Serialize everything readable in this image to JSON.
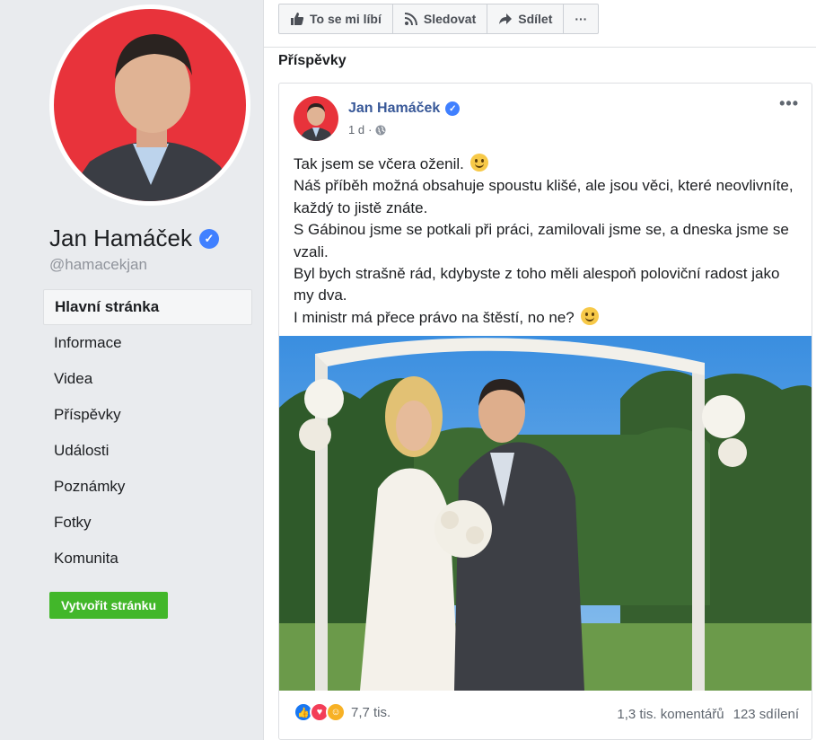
{
  "sidebar": {
    "page_name": "Jan Hamáček",
    "handle": "@hamacekjan",
    "nav": [
      {
        "label": "Hlavní stránka"
      },
      {
        "label": "Informace"
      },
      {
        "label": "Videa"
      },
      {
        "label": "Příspěvky"
      },
      {
        "label": "Události"
      },
      {
        "label": "Poznámky"
      },
      {
        "label": "Fotky"
      },
      {
        "label": "Komunita"
      }
    ],
    "create_button": "Vytvořit stránku"
  },
  "actions": {
    "like": "To se mi líbí",
    "follow": "Sledovat",
    "share": "Sdílet",
    "more": "···"
  },
  "section_title": "Příspěvky",
  "post": {
    "author": "Jan Hamáček",
    "time": "1 d",
    "more": "•••",
    "lines": [
      "Tak jsem se včera oženil.",
      "Náš příběh možná obsahuje spoustu klišé, ale jsou věci, které neovlivníte, každý to jistě znáte.",
      "S Gábinou jsme se potkali při práci, zamilovali jsme se, a dneska jsme se vzali.",
      "Byl bych strašně rád, kdybyste z toho měli alespoň poloviční radost jako my dva.",
      "I ministr má přece právo na štěstí, no ne?"
    ],
    "reactions_count": "7,7 tis.",
    "comments": "1,3 tis. komentářů",
    "shares": "123 sdílení"
  },
  "colors": {
    "link_blue": "#385898",
    "verified_blue": "#4080ff",
    "green_button": "#42b72a",
    "avatar_red": "#e8333b"
  }
}
